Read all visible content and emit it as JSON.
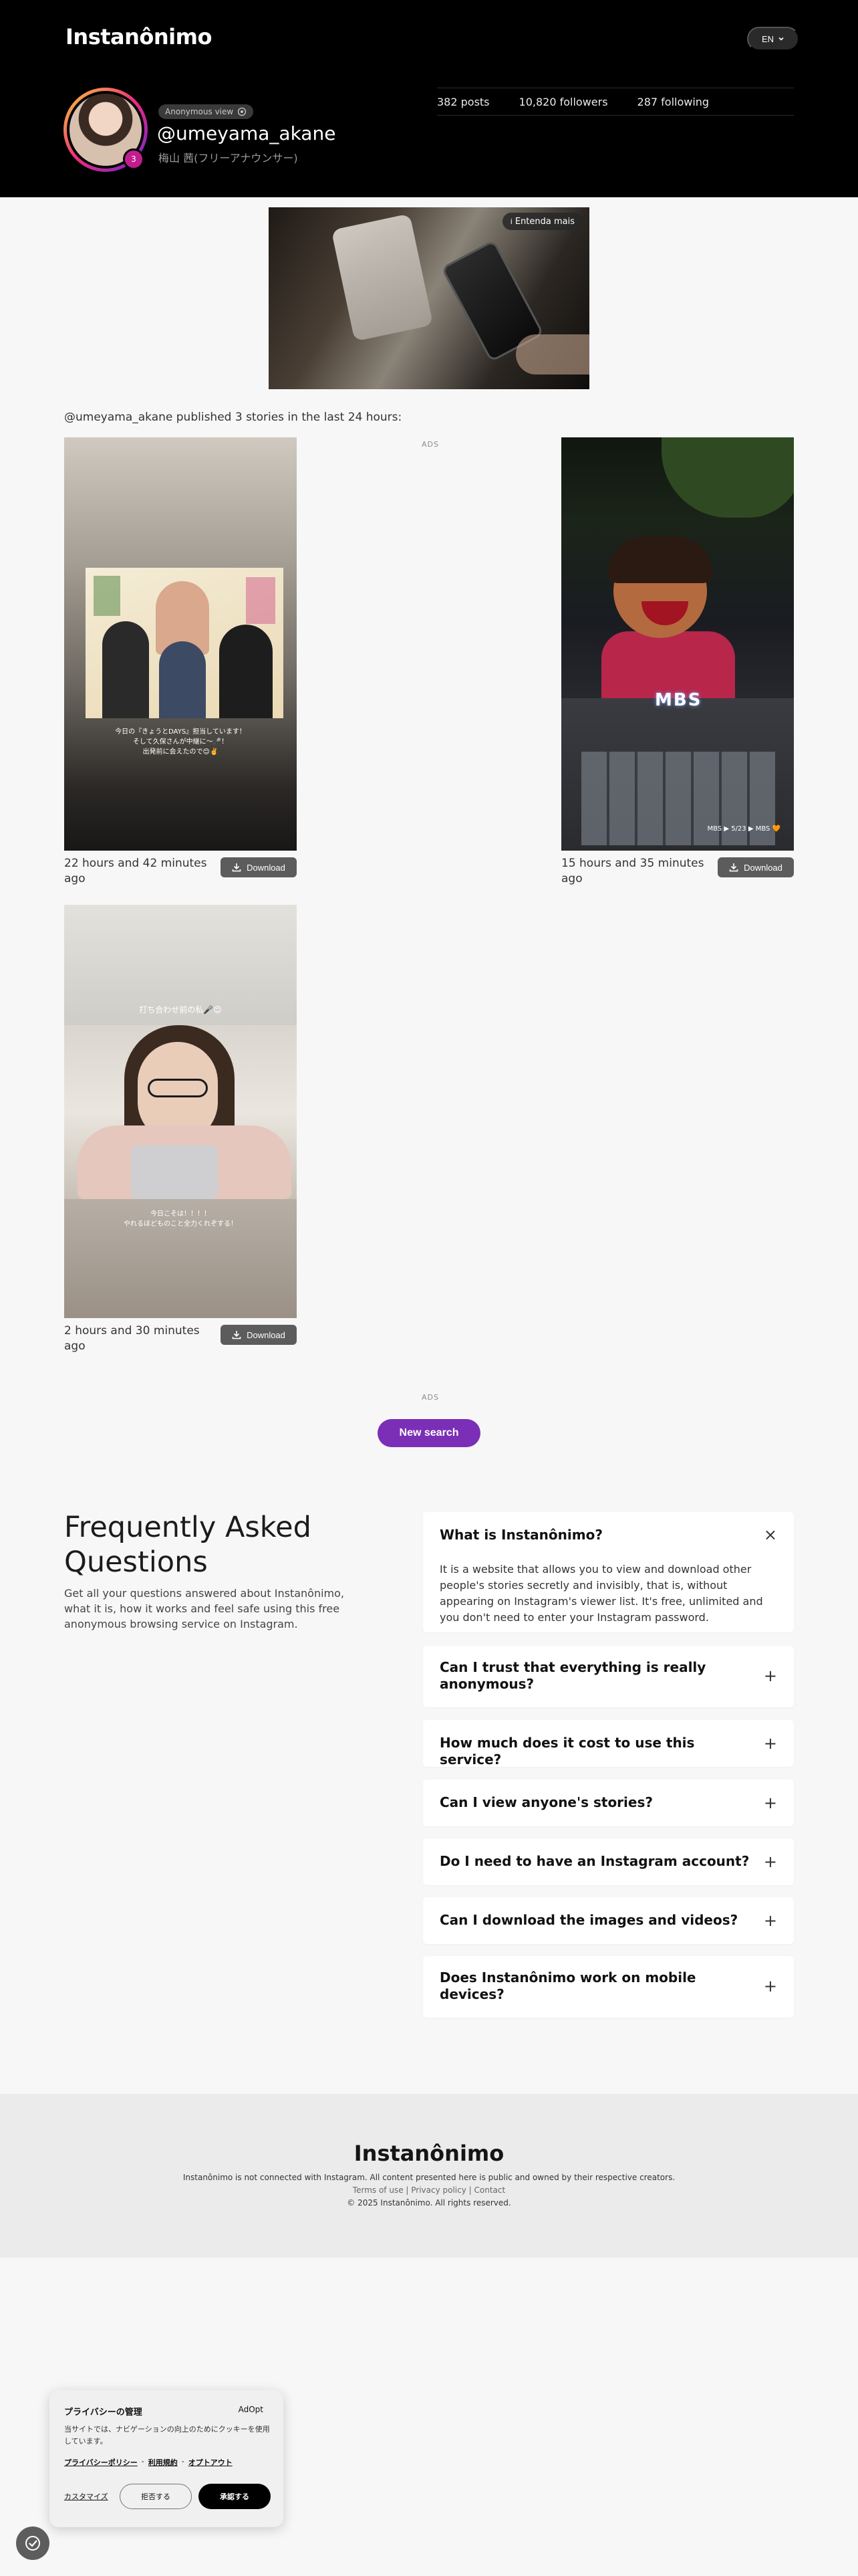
{
  "header": {
    "brand": "Instanônimo",
    "lang": "EN",
    "anon_label": "Anonymous view",
    "story_count": "3",
    "username": "@umeyama_akane",
    "realname": "梅山 茜(フリーアナウンサー)",
    "stats": {
      "posts": "382 posts",
      "followers": "10,820 followers",
      "following": "287 following"
    }
  },
  "ad": {
    "pill": "Entenda mais"
  },
  "published_text": "@umeyama_akane published 3 stories in the last 24 hours:",
  "ads_label": "ADS",
  "stories": [
    {
      "time": "22 hours and 42 minutes ago",
      "download": "Download",
      "caption": "今日の『きょうとDAYS』担当しています！\nそして久保さんが中継に〜🎤！\n出発前に会えたので😊✌️"
    },
    {
      "time": "15 hours and 35 minutes ago",
      "download": "Download",
      "sign": "MBS",
      "caption": "MBS ▶ 5/23 ▶ MBS 🧡"
    },
    {
      "time": "2 hours and 30 minutes ago",
      "download": "Download",
      "caption_top": "打ち合わせ前の私🎤😊",
      "caption_bottom": "今日こそは！！！！\nやれるほどものこと全力くれぞする！"
    }
  ],
  "new_search": "New search",
  "faq": {
    "title": "Frequently Asked Questions",
    "subtitle": "Get all your questions answered about Instanônimo, what it is, how it works and feel safe using this free anonymous browsing service on Instagram.",
    "items": [
      {
        "q": "What is Instanônimo?",
        "a": "It is a website that allows you to view and download other people's stories secretly and invisibly, that is, without appearing on Instagram's viewer list. It's free, unlimited and you don't need to enter your Instagram password.",
        "toggle": "×"
      },
      {
        "q": "Can I trust that everything is really anonymous?",
        "toggle": "+"
      },
      {
        "q": "How much does it cost to use this service?",
        "toggle": "+"
      },
      {
        "q": "Can I view anyone's stories?",
        "toggle": "+"
      },
      {
        "q": "Do I need to have an Instagram account?",
        "toggle": "+"
      },
      {
        "q": "Can I download the images and videos?",
        "toggle": "+"
      },
      {
        "q": "Does Instanônimo work on mobile devices?",
        "toggle": "+"
      }
    ]
  },
  "footer": {
    "brand": "Instanônimo",
    "note": "Instanônimo is not connected with Instagram. All content presented here is public and owned by their respective creators.",
    "terms": "Terms of use",
    "privacy": "Privacy policy",
    "contact": "Contact",
    "copyright": "© 2025 Instanônimo. All rights reserved."
  },
  "cookie": {
    "title": "プライバシーの管理",
    "brand": "AdOpt",
    "text": "当サイトでは、ナビゲーションの向上のためにクッキーを使用しています。",
    "privacy_link": "プライバシーポリシー",
    "terms_link": "利用規約",
    "optout_link": "オプトアウト",
    "customize": "カスタマイズ",
    "reject": "拒否する",
    "accept": "承認する"
  }
}
